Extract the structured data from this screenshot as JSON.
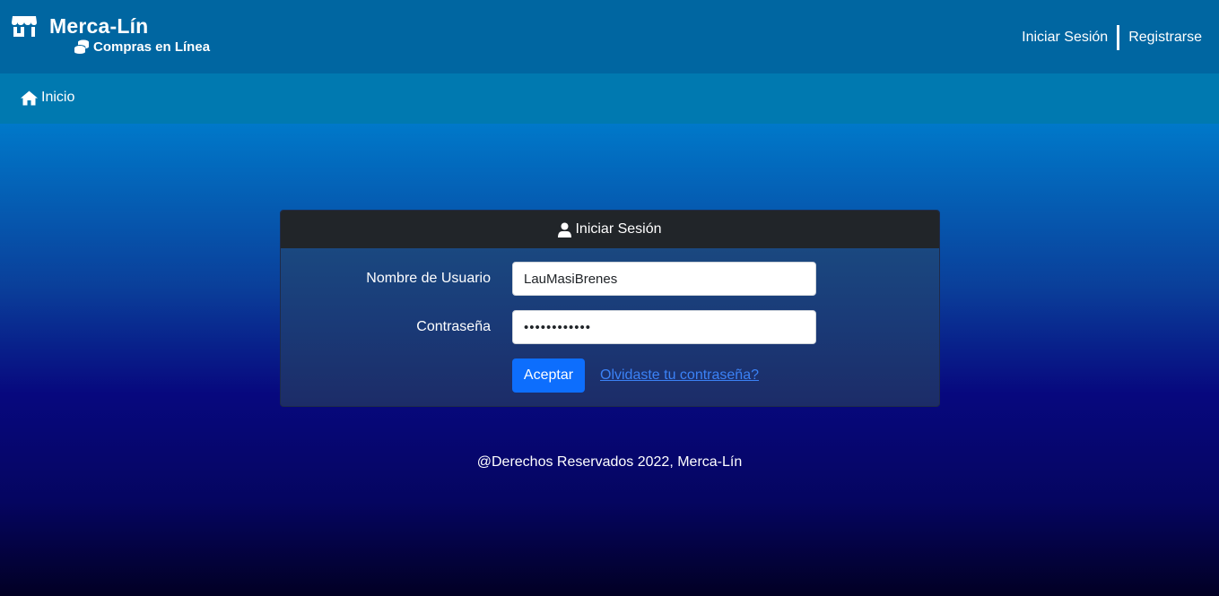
{
  "brand": {
    "title": "Merca-Lín",
    "subtitle": "Compras en Línea",
    "icon": "store-icon",
    "subtitle_icon": "coins-icon"
  },
  "topnav": {
    "login_label": "Iniciar Sesión",
    "register_label": "Registrarse"
  },
  "navbar": {
    "home_label": "Inicio",
    "home_icon": "home-icon"
  },
  "login_card": {
    "header_label": "Iniciar Sesión",
    "header_icon": "user-icon",
    "username_label": "Nombre de Usuario",
    "username_value": "LauMasiBrenes",
    "password_label": "Contraseña",
    "password_value": "••••••••••••",
    "submit_label": "Aceptar",
    "forgot_label": "Olvidaste tu contraseña?"
  },
  "footer": {
    "text": "@Derechos Reservados 2022, Merca-Lín"
  },
  "colors": {
    "topbar": "#0066a1",
    "navbar": "#0079b0",
    "card_header": "#212529",
    "primary_button": "#0d6efd",
    "link": "#3b82f6"
  }
}
